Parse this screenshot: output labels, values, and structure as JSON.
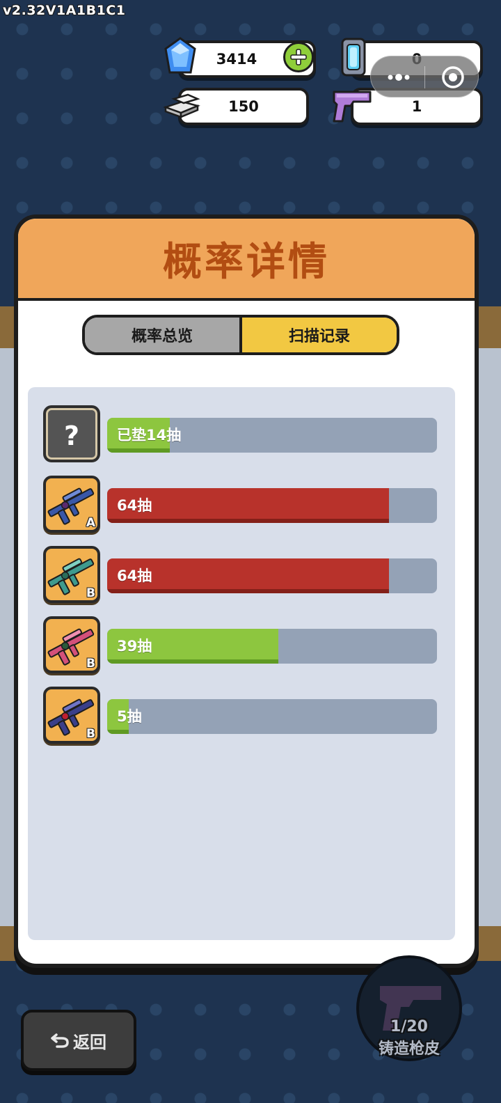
{
  "version": "v2.32V1A1B1C1",
  "currencies": {
    "gems": "3414",
    "silver": "150",
    "energy": "0",
    "pistol": "1"
  },
  "panel": {
    "title": "概率详情",
    "tabs": [
      {
        "label": "概率总览",
        "active": false
      },
      {
        "label": "扫描记录",
        "active": true
      }
    ]
  },
  "records": [
    {
      "label": "已垫14抽",
      "grade": "",
      "unknown": true,
      "color": "green",
      "fraction": 0.19
    },
    {
      "label": "64抽",
      "grade": "A",
      "unknown": false,
      "color": "red",
      "fraction": 0.855,
      "weapon_color": "#3a57a8"
    },
    {
      "label": "64抽",
      "grade": "B",
      "unknown": false,
      "color": "red",
      "fraction": 0.855,
      "weapon_color": "#3e9a8e"
    },
    {
      "label": "39抽",
      "grade": "B",
      "unknown": false,
      "color": "green",
      "fraction": 0.52,
      "weapon_color": "#d4507a"
    },
    {
      "label": "5抽",
      "grade": "B",
      "unknown": false,
      "color": "green",
      "fraction": 0.065,
      "weapon_color": "#3a3f8a"
    }
  ],
  "footer": {
    "back_label": "返回",
    "craft_count": "1/20",
    "craft_label": "铸造枪皮"
  },
  "colors": {
    "accent_orange": "#f0a65a",
    "title_text": "#b24d12",
    "tab_active": "#f2c842",
    "bar_green": "#8dc63f",
    "bar_red": "#b8322b"
  }
}
